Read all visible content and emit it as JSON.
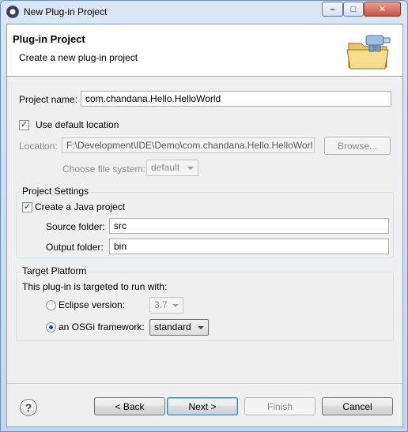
{
  "window": {
    "title": "New Plug-in Project"
  },
  "header": {
    "title": "Plug-in Project",
    "description": "Create a new plug-in project"
  },
  "project_name": {
    "label": "Project name:",
    "value": "com.chandana.Hello.HelloWorld"
  },
  "default_location": {
    "checkbox_label": "Use default location",
    "checked": true,
    "location_label": "Location:",
    "location_value": "F:\\Development\\IDE\\Demo\\com.chandana.Hello.HelloWorl",
    "browse_label": "Browse...",
    "file_system_label": "Choose file system:",
    "file_system_value": "default"
  },
  "project_settings": {
    "title": "Project Settings",
    "java_checkbox_label": "Create a Java project",
    "java_checked": true,
    "source_label": "Source folder:",
    "source_value": "src",
    "output_label": "Output folder:",
    "output_value": "bin"
  },
  "target_platform": {
    "title": "Target Platform",
    "description": "This plug-in is targeted to run with:",
    "eclipse_label": "Eclipse version:",
    "eclipse_value": "3.7",
    "osgi_label": "an OSGi framework:",
    "osgi_value": "standard",
    "selected": "osgi"
  },
  "buttons": {
    "back": "< Back",
    "next": "Next >",
    "finish": "Finish",
    "cancel": "Cancel"
  },
  "icons": {
    "help": "?",
    "checkmark": "✓",
    "minimize": "–",
    "maximize": "□",
    "close": "✕"
  }
}
